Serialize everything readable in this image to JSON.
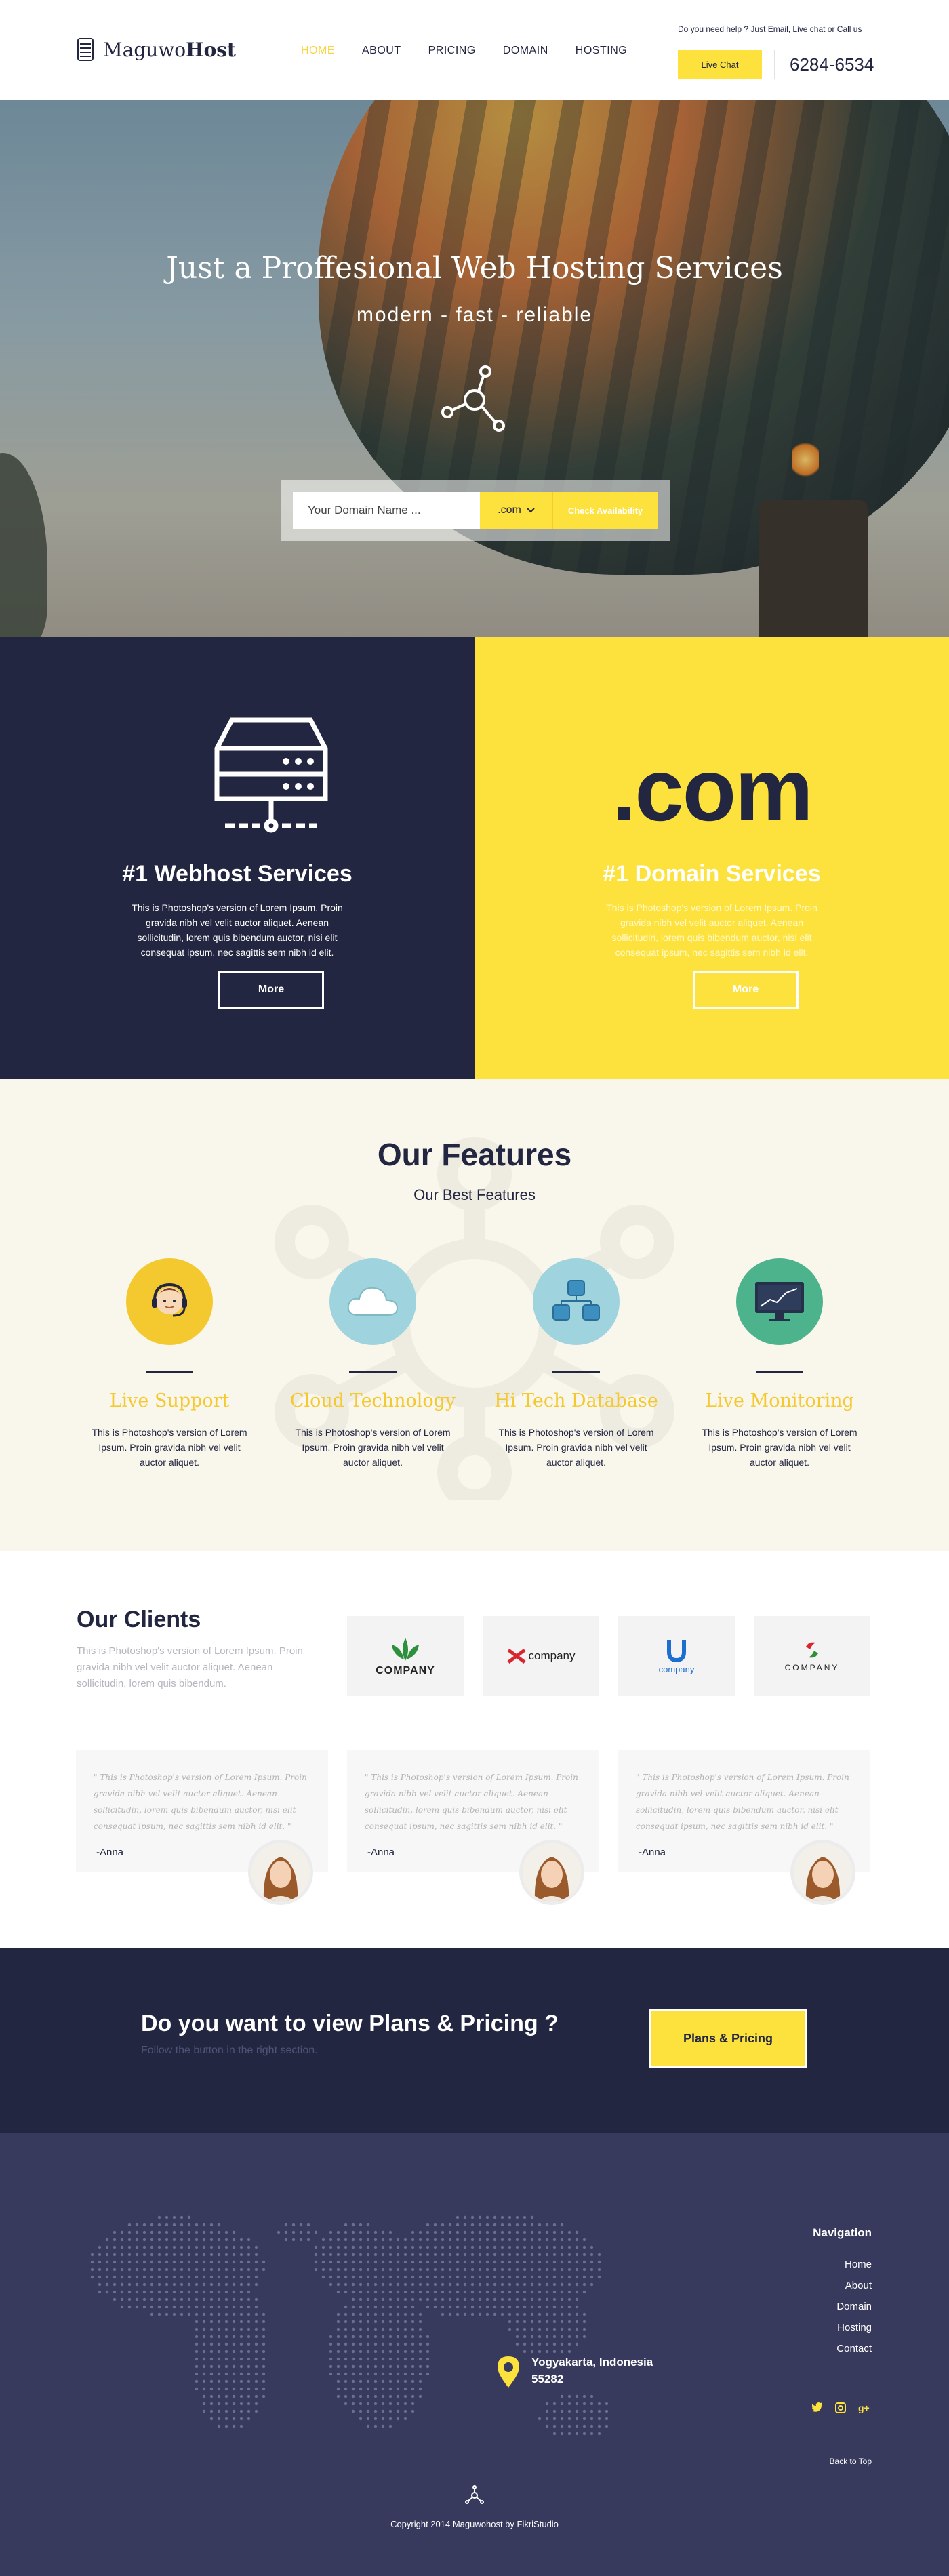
{
  "header": {
    "brand_light": "Maguwo",
    "brand_bold": "Host",
    "nav": [
      "HOME",
      "ABOUT",
      "PRICING",
      "DOMAIN",
      "HOSTING"
    ],
    "active_nav": "HOME",
    "help_text": "Do you need help ? Just Email, Live chat or Call us",
    "live_chat_label": "Live Chat",
    "phone": "6284-6534"
  },
  "hero": {
    "title": "Just a Proffesional Web Hosting Services",
    "tagline": "modern  -  fast  -  reliable",
    "search_placeholder": "Your Domain Name ...",
    "tld_selected": ".com",
    "check_label": "Check Availability"
  },
  "services": {
    "left": {
      "title": "#1 Webhost Services",
      "text": "This is Photoshop's version  of Lorem Ipsum. Proin gravida nibh vel velit auctor aliquet. Aenean sollicitudin, lorem quis bibendum auctor, nisi elit consequat ipsum, nec sagittis sem nibh id elit.",
      "button": "More"
    },
    "right": {
      "big": ".com",
      "title": "#1 Domain Services",
      "text": "This is Photoshop's version  of Lorem Ipsum. Proin gravida nibh vel velit auctor aliquet. Aenean sollicitudin, lorem quis bibendum auctor, nisi elit consequat ipsum, nec sagittis sem nibh id elit.",
      "button": "More"
    }
  },
  "features": {
    "title": "Our Features",
    "subtitle": "Our Best Features",
    "items": [
      {
        "title": "Live Support",
        "text": "This is Photoshop's version  of Lorem Ipsum. Proin gravida nibh vel velit auctor aliquet.",
        "icon": "headset-agent-icon",
        "color": "#f4c930"
      },
      {
        "title": "Cloud Technology",
        "text": "This is Photoshop's version  of Lorem Ipsum. Proin gravida nibh vel velit auctor aliquet.",
        "icon": "cloud-icon",
        "color": "#9fd4de"
      },
      {
        "title": "Hi Tech Database",
        "text": "This is Photoshop's version  of Lorem Ipsum. Proin gravida nibh vel velit auctor aliquet.",
        "icon": "database-icon",
        "color": "#9fd4de"
      },
      {
        "title": "Live Monitoring",
        "text": "This is Photoshop's version  of Lorem Ipsum. Proin gravida nibh vel velit auctor aliquet.",
        "icon": "monitor-chart-icon",
        "color": "#4db38c"
      }
    ]
  },
  "clients": {
    "title": "Our Clients",
    "description": "This is Photoshop's version  of Lorem Ipsum. Proin gravida nibh vel velit auctor aliquet. Aenean sollicitudin, lorem quis bibendum.",
    "logos": [
      "COMPANY",
      "company",
      "company",
      "COMPANY"
    ],
    "testimonials": [
      {
        "quote": "\" This is Photoshop's version  of Lorem Ipsum. Proin gravida nibh vel velit auctor aliquet. Aenean sollicitudin, lorem quis bibendum auctor, nisi elit consequat ipsum, nec sagittis sem nibh id elit. \"",
        "author": "-Anna"
      },
      {
        "quote": "\" This is Photoshop's version  of Lorem Ipsum. Proin gravida nibh vel velit auctor aliquet. Aenean sollicitudin, lorem quis bibendum auctor, nisi elit consequat ipsum, nec sagittis sem nibh id elit. \"",
        "author": "-Anna"
      },
      {
        "quote": "\" This is Photoshop's version  of Lorem Ipsum. Proin gravida nibh vel velit auctor aliquet. Aenean sollicitudin, lorem quis bibendum auctor, nisi elit consequat ipsum, nec sagittis sem nibh id elit. \"",
        "author": "-Anna"
      }
    ]
  },
  "cta": {
    "title": "Do you want to view Plans & Pricing ?",
    "subtitle": "Follow the button in the right section.",
    "button": "Plans & Pricing"
  },
  "footer": {
    "location_line1": "Yogyakarta, Indonesia",
    "location_line2": "55282",
    "nav_title": "Navigation",
    "nav": [
      "Home",
      "About",
      "Domain",
      "Hosting",
      "Contact"
    ],
    "social": [
      "twitter-icon",
      "instagram-icon",
      "google-plus-icon"
    ],
    "back_to_top": "Back to Top",
    "copyright": "Copyright 2014 Maguwohost by FikriStudio"
  },
  "colors": {
    "navy": "#222641",
    "yellow": "#fde23e",
    "footer": "#383a5d",
    "cream": "#f9f6ec"
  }
}
